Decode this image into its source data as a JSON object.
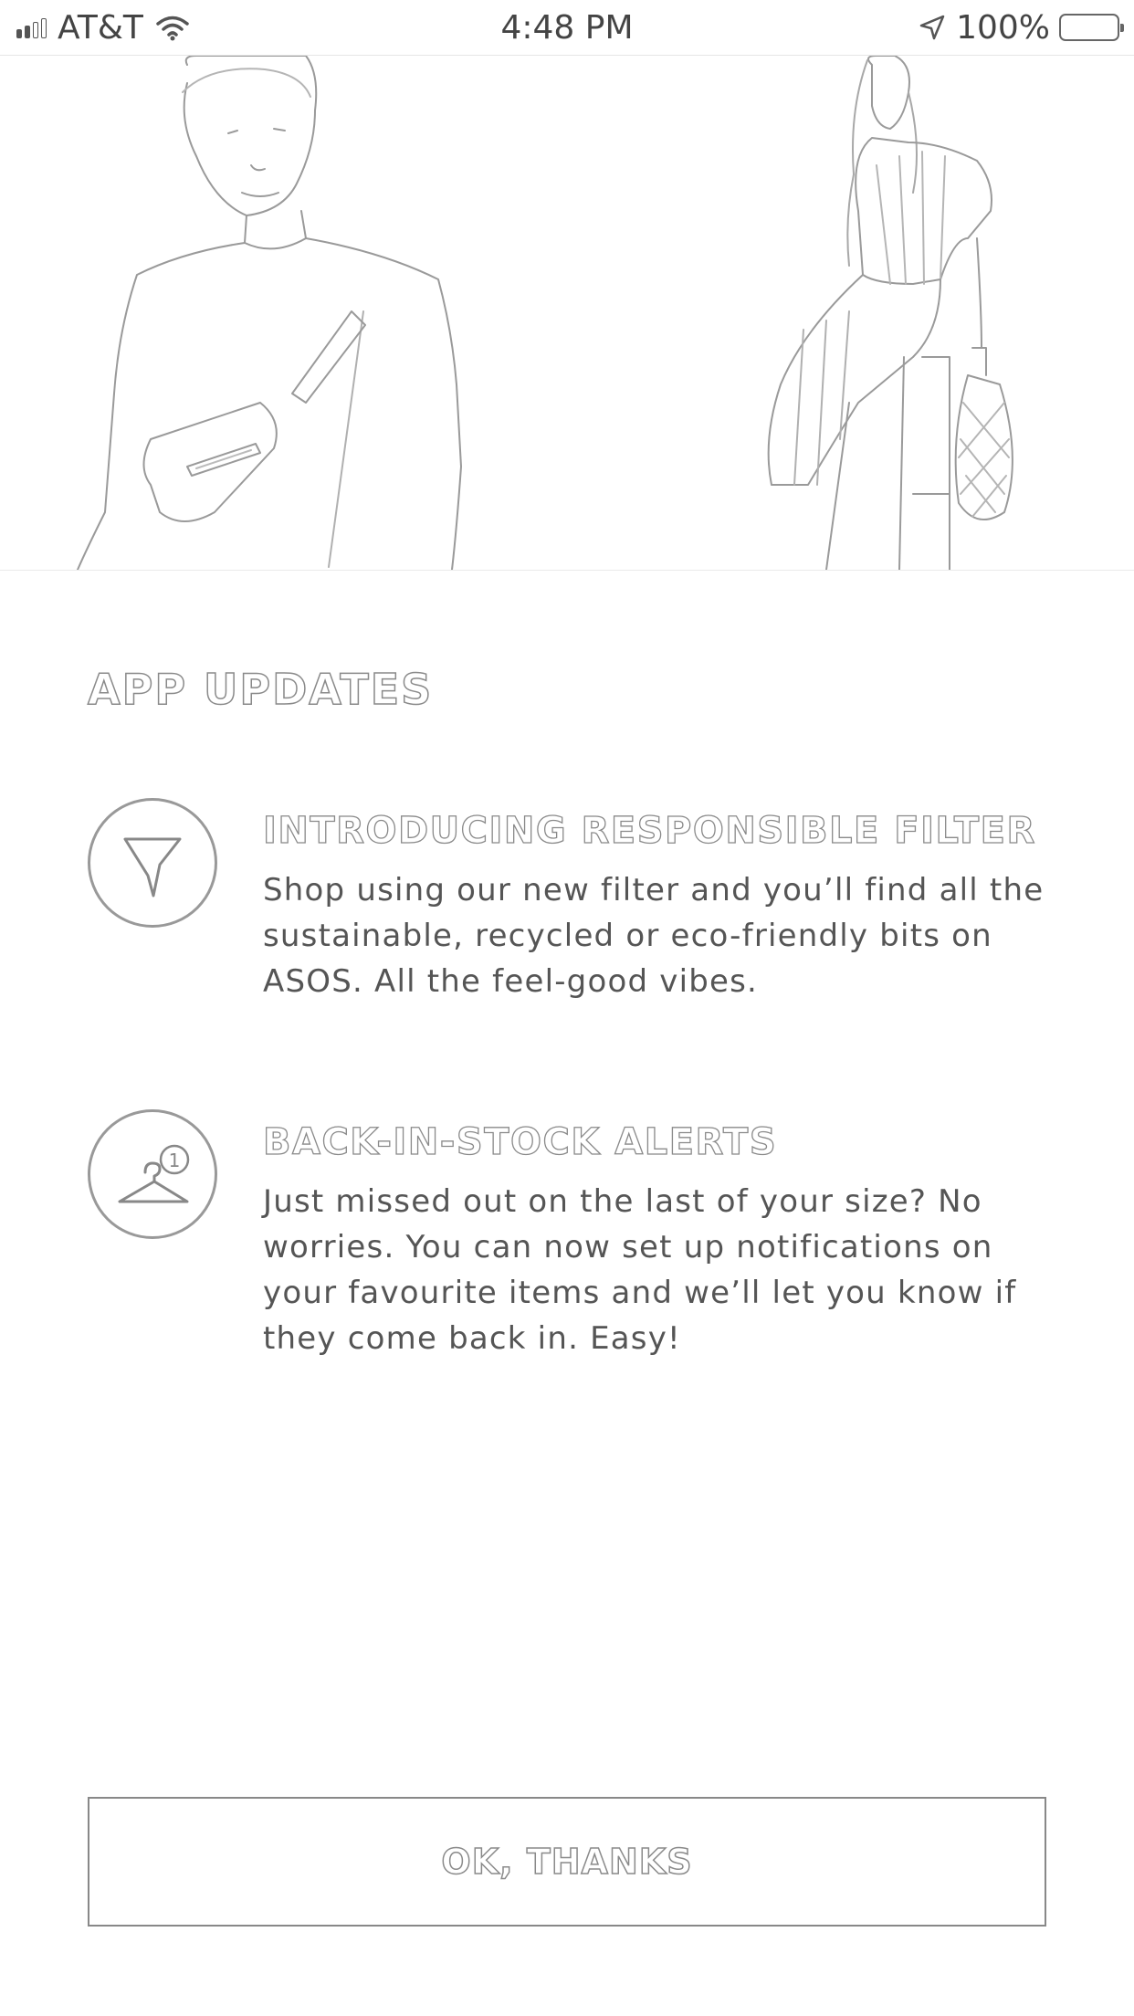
{
  "status_bar": {
    "carrier": "AT&T",
    "time": "4:48 PM",
    "battery": "100%"
  },
  "main": {
    "section_title": "APP UPDATES",
    "features": [
      {
        "heading": "INTRODUCING RESPONSIBLE FILTER",
        "body": "Shop using our new filter and you’ll find all the sustainable, recycled or eco-friendly bits on ASOS. All the feel-good vibes.",
        "icon": "filter-icon"
      },
      {
        "heading": "BACK-IN-STOCK ALERTS",
        "body": "Just missed out on the last of your size? No worries. You can now set up notifications on your favourite items and we’ll let you know if they come back in. Easy!",
        "icon": "hanger-alert-icon",
        "badge": "1"
      }
    ],
    "ok_label": "OK, THANKS"
  }
}
